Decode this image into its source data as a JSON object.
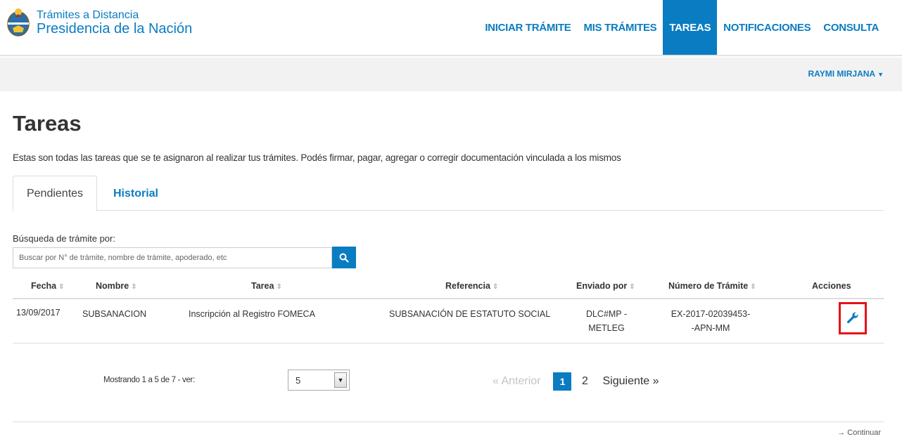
{
  "brand": {
    "line1": "Trámites a Distancia",
    "line2": "Presidencia de la Nación"
  },
  "nav": [
    {
      "label": "INICIAR TRÁMITE",
      "active": false
    },
    {
      "label": "MIS TRÁMITES",
      "active": false
    },
    {
      "label": "TAREAS",
      "active": true
    },
    {
      "label": "NOTIFICACIONES",
      "active": false
    },
    {
      "label": "CONSULTA",
      "active": false
    }
  ],
  "user": {
    "name": "RAYMI MIRJANA"
  },
  "page": {
    "title": "Tareas",
    "description": "Estas son todas las tareas que se te asignaron al realizar tus trámites. Podés firmar, pagar, agregar o corregir documentación vinculada a los mismos"
  },
  "tabs": {
    "pendientes": "Pendientes",
    "historial": "Historial"
  },
  "search": {
    "label": "Búsqueda de trámite por:",
    "placeholder": "Buscar por N° de trámite, nombre de trámite, apoderado, etc"
  },
  "table": {
    "headers": {
      "fecha": "Fecha",
      "nombre": "Nombre",
      "tarea": "Tarea",
      "referencia": "Referencia",
      "enviado": "Enviado por",
      "numero": "Número de Trámite",
      "acciones": "Acciones"
    },
    "rows": [
      {
        "fecha": "13/09/2017",
        "nombre": "SUBSANACION",
        "tarea": "Inscripción al Registro FOMECA",
        "referencia": "SUBSANACIÓN DE ESTATUTO SOCIAL",
        "enviado_l1": "DLC#MP -",
        "enviado_l2": "METLEG",
        "numero_l1": "EX-2017-02039453-",
        "numero_l2": "-APN-MM"
      }
    ]
  },
  "pagination": {
    "showing": "Mostrando 1 a 5 de 7 - ver:",
    "page_size": "5",
    "prev": "« Anterior",
    "pages": [
      "1",
      "2"
    ],
    "next": "Siguiente »"
  },
  "footer": {
    "continuar": "Continuar"
  },
  "colors": {
    "primary": "#0a7cc1",
    "highlight": "#e8101a"
  }
}
